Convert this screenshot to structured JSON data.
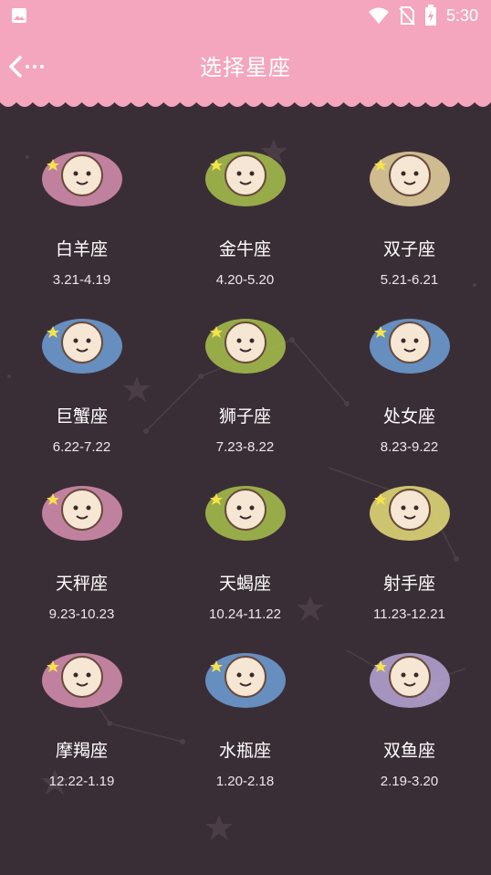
{
  "status_bar": {
    "time": "5:30",
    "icons": [
      "image-icon",
      "wifi-icon",
      "no-sim-icon",
      "battery-charging-icon"
    ]
  },
  "header": {
    "title": "选择星座",
    "back_icon": "back-arrow-icon"
  },
  "colors": {
    "header_bg": "#f3a6bd",
    "content_bg": "#3a2e36"
  },
  "zodiac": [
    {
      "name": "白羊座",
      "date": "3.21-4.19",
      "icon": "aries-icon",
      "blob": "#d88fb0"
    },
    {
      "name": "金牛座",
      "date": "4.20-5.20",
      "icon": "taurus-icon",
      "blob": "#a8c24c"
    },
    {
      "name": "双子座",
      "date": "5.21-6.21",
      "icon": "gemini-icon",
      "blob": "#e9d4a0"
    },
    {
      "name": "巨蟹座",
      "date": "6.22-7.22",
      "icon": "cancer-icon",
      "blob": "#6f9fd6"
    },
    {
      "name": "狮子座",
      "date": "7.23-8.22",
      "icon": "leo-icon",
      "blob": "#a8c24c"
    },
    {
      "name": "处女座",
      "date": "8.23-9.22",
      "icon": "virgo-icon",
      "blob": "#6f9fd6"
    },
    {
      "name": "天秤座",
      "date": "9.23-10.23",
      "icon": "libra-icon",
      "blob": "#d88fb0"
    },
    {
      "name": "天蝎座",
      "date": "10.24-11.22",
      "icon": "scorpio-icon",
      "blob": "#a8c24c"
    },
    {
      "name": "射手座",
      "date": "11.23-12.21",
      "icon": "sagittarius-icon",
      "blob": "#e8de7a"
    },
    {
      "name": "摩羯座",
      "date": "12.22-1.19",
      "icon": "capricorn-icon",
      "blob": "#d88fb0"
    },
    {
      "name": "水瓶座",
      "date": "1.20-2.18",
      "icon": "aquarius-icon",
      "blob": "#6f9fd6"
    },
    {
      "name": "双鱼座",
      "date": "2.19-3.20",
      "icon": "pisces-icon",
      "blob": "#b7a6d6"
    }
  ]
}
